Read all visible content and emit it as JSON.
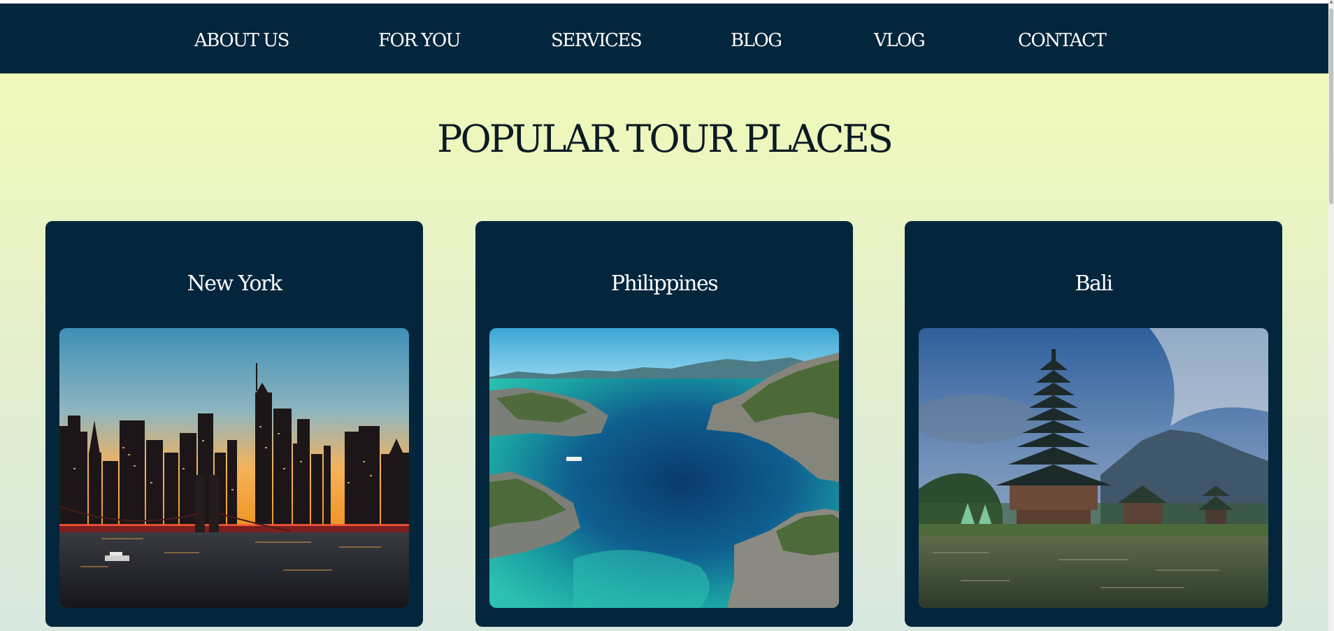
{
  "nav": {
    "items": [
      {
        "label": "ABOUT US"
      },
      {
        "label": "FOR YOU"
      },
      {
        "label": "SERVICES"
      },
      {
        "label": "BLOG"
      },
      {
        "label": "VLOG"
      },
      {
        "label": "CONTACT"
      }
    ]
  },
  "main": {
    "title": "POPULAR TOUR PLACES",
    "cards": [
      {
        "title": "New York",
        "image": "new-york-skyline-at-sunset-image"
      },
      {
        "title": "Philippines",
        "image": "philippines-lagoon-islands-image"
      },
      {
        "title": "Bali",
        "image": "bali-temple-pagoda-image"
      }
    ]
  },
  "colors": {
    "nav_bg": "#04263d",
    "card_bg": "#04263d",
    "page_bg_top": "#f1fbb4",
    "page_bg_bottom": "#d8e8df",
    "title_text": "#0c1a24",
    "nav_text": "#ffffff"
  }
}
